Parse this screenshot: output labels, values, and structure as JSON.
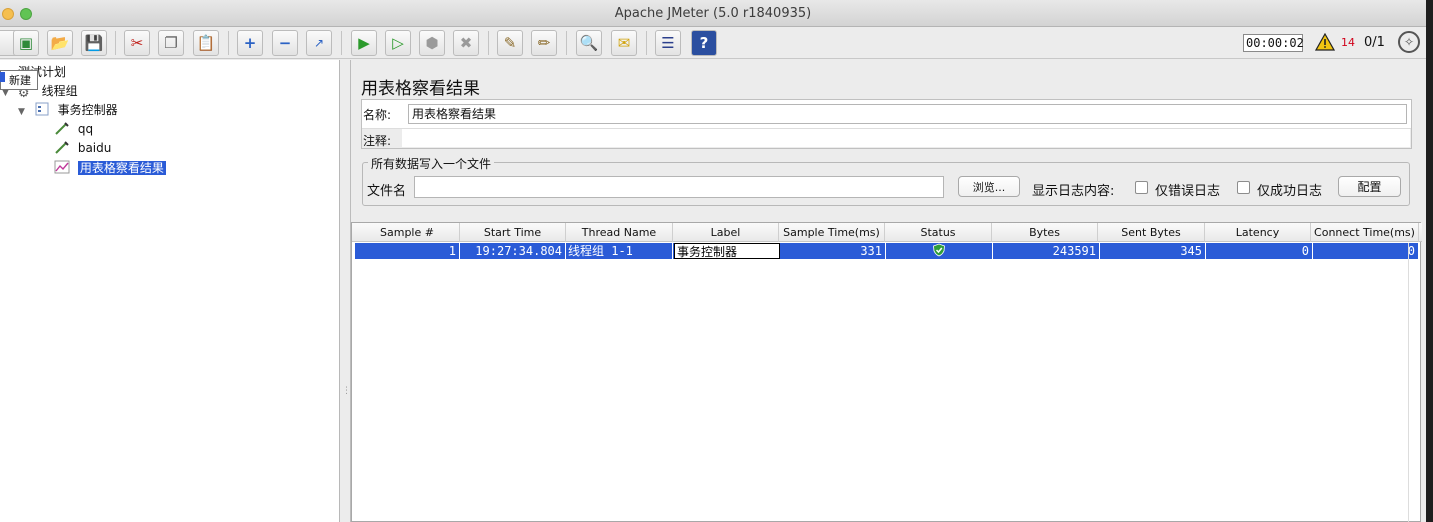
{
  "window": {
    "title": "Apache JMeter (5.0 r1840935)"
  },
  "toolbar": {
    "timer": "00:00:02",
    "warning_count": "14",
    "threads": "0/1"
  },
  "tooltip": {
    "text": "新建"
  },
  "tree": {
    "root": "测试计划",
    "thread_group": "线程组",
    "controller": "事务控制器",
    "sampler1": "qq",
    "sampler2": "baidu",
    "listener": "用表格察看结果"
  },
  "panel": {
    "title": "用表格察看结果",
    "name_label": "名称:",
    "name_value": "用表格察看结果",
    "comment_label": "注释:",
    "comment_value": "",
    "file_group_label": "所有数据写入一个文件",
    "file_label": "文件名",
    "file_value": "",
    "browse_button": "浏览...",
    "log_content_label": "显示日志内容:",
    "errors_only_label": "仅错误日志",
    "success_only_label": "仅成功日志",
    "configure_button": "配置"
  },
  "table": {
    "columns": [
      "Sample #",
      "Start Time",
      "Thread Name",
      "Label",
      "Sample Time(ms)",
      "Status",
      "Bytes",
      "Sent Bytes",
      "Latency",
      "Connect Time(ms)"
    ],
    "rows": [
      {
        "sample": "1",
        "start_time": "19:27:34.804",
        "thread_name": "线程组 1-1",
        "label": "事务控制器",
        "sample_time": "331",
        "status": "success-shield-icon",
        "bytes": "243591",
        "sent_bytes": "345",
        "latency": "0",
        "connect_time": "0"
      }
    ]
  },
  "colors": {
    "selection": "#2a5bd7",
    "warning": "#d0021b",
    "status_ok": "#2e9e3a"
  }
}
